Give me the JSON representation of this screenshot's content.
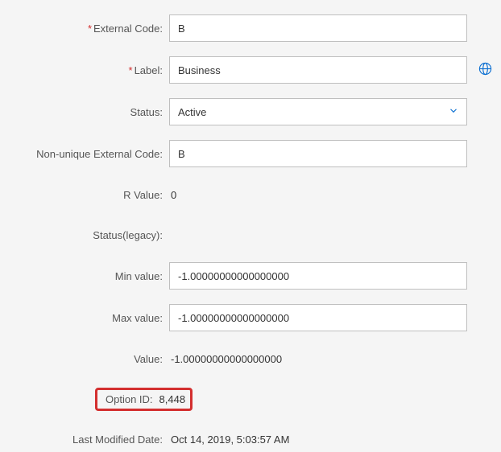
{
  "labels": {
    "externalCode": "External Code:",
    "label": "Label:",
    "status": "Status:",
    "nonUniqueExternalCode": "Non-unique External Code:",
    "rValue": "R Value:",
    "statusLegacy": "Status(legacy):",
    "minValue": "Min value:",
    "maxValue": "Max value:",
    "value": "Value:",
    "optionId": "Option ID:",
    "lastModifiedDate": "Last Modified Date:"
  },
  "values": {
    "externalCode": "B",
    "label": "Business",
    "status": "Active",
    "nonUniqueExternalCode": "B",
    "rValue": "0",
    "statusLegacy": "",
    "minValue": "-1.00000000000000000",
    "maxValue": "-1.00000000000000000",
    "value": "-1.00000000000000000",
    "optionId": "8,448",
    "lastModifiedDate": "Oct 14, 2019, 5:03:57 AM"
  }
}
